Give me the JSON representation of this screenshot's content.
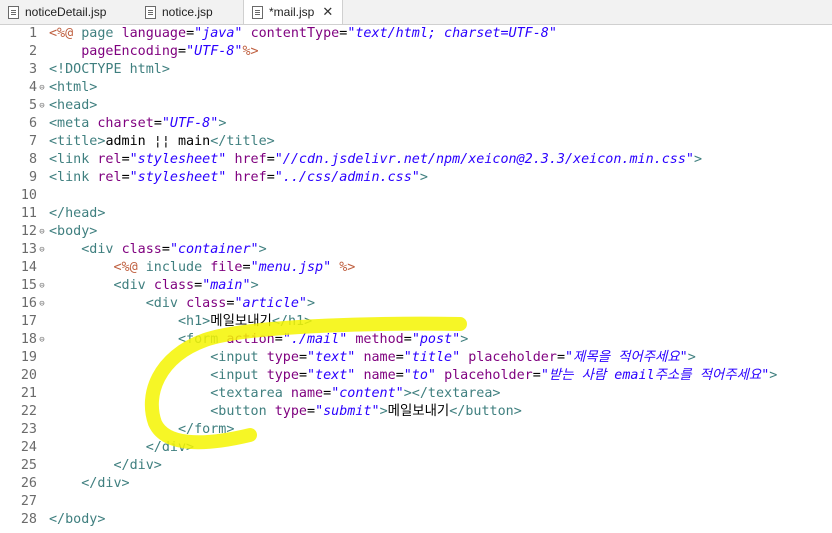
{
  "tabs": [
    {
      "label": "noticeDetail.jsp",
      "active": false
    },
    {
      "label": "notice.jsp",
      "active": false
    },
    {
      "label": "*mail.jsp",
      "active": true,
      "close": "✕"
    }
  ],
  "colors": {
    "tag": "#3f7f7f",
    "attribute": "#7f007f",
    "string": "#2a00ff",
    "directive": "#bf5f3f",
    "highlighter": "#f5f500"
  },
  "lines": [
    {
      "n": "1",
      "fold": "",
      "tokens": [
        [
          "d",
          "<%@ "
        ],
        [
          "t",
          "page "
        ],
        [
          "a",
          "language"
        ],
        [
          "x",
          "="
        ],
        [
          "s",
          "\"java\""
        ],
        [
          "x",
          " "
        ],
        [
          "a",
          "contentType"
        ],
        [
          "x",
          "="
        ],
        [
          "s",
          "\"text/html; charset=UTF-8\""
        ]
      ]
    },
    {
      "n": "2",
      "fold": "",
      "tokens": [
        [
          "x",
          "    "
        ],
        [
          "a",
          "pageEncoding"
        ],
        [
          "x",
          "="
        ],
        [
          "s",
          "\"UTF-8\""
        ],
        [
          "d",
          "%>"
        ]
      ]
    },
    {
      "n": "3",
      "fold": "",
      "tokens": [
        [
          "t",
          "<!DOCTYPE html>"
        ]
      ]
    },
    {
      "n": "4",
      "fold": "⊖",
      "tokens": [
        [
          "t",
          "<html>"
        ]
      ]
    },
    {
      "n": "5",
      "fold": "⊖",
      "tokens": [
        [
          "t",
          "<head>"
        ]
      ]
    },
    {
      "n": "6",
      "fold": "",
      "tokens": [
        [
          "t",
          "<meta "
        ],
        [
          "a",
          "charset"
        ],
        [
          "x",
          "="
        ],
        [
          "s",
          "\"UTF-8\""
        ],
        [
          "t",
          ">"
        ]
      ]
    },
    {
      "n": "7",
      "fold": "",
      "tokens": [
        [
          "t",
          "<title>"
        ],
        [
          "x",
          "admin ¦¦ main"
        ],
        [
          "t",
          "</title>"
        ]
      ]
    },
    {
      "n": "8",
      "fold": "",
      "tokens": [
        [
          "t",
          "<link "
        ],
        [
          "a",
          "rel"
        ],
        [
          "x",
          "="
        ],
        [
          "s",
          "\"stylesheet\""
        ],
        [
          "x",
          " "
        ],
        [
          "a",
          "href"
        ],
        [
          "x",
          "="
        ],
        [
          "s",
          "\"//cdn.jsdelivr.net/npm/xeicon@2.3.3/xeicon.min.css\""
        ],
        [
          "t",
          ">"
        ]
      ]
    },
    {
      "n": "9",
      "fold": "",
      "tokens": [
        [
          "t",
          "<link "
        ],
        [
          "a",
          "rel"
        ],
        [
          "x",
          "="
        ],
        [
          "s",
          "\"stylesheet\""
        ],
        [
          "x",
          " "
        ],
        [
          "a",
          "href"
        ],
        [
          "x",
          "="
        ],
        [
          "s",
          "\"../css/admin.css\""
        ],
        [
          "t",
          ">"
        ]
      ]
    },
    {
      "n": "10",
      "fold": "",
      "tokens": []
    },
    {
      "n": "11",
      "fold": "",
      "tokens": [
        [
          "t",
          "</head>"
        ]
      ]
    },
    {
      "n": "12",
      "fold": "⊖",
      "tokens": [
        [
          "t",
          "<body>"
        ]
      ]
    },
    {
      "n": "13",
      "fold": "⊖",
      "tokens": [
        [
          "x",
          "    "
        ],
        [
          "t",
          "<div "
        ],
        [
          "a",
          "class"
        ],
        [
          "x",
          "="
        ],
        [
          "s",
          "\"container\""
        ],
        [
          "t",
          ">"
        ]
      ]
    },
    {
      "n": "14",
      "fold": "",
      "tokens": [
        [
          "x",
          "        "
        ],
        [
          "d",
          "<%@ "
        ],
        [
          "t",
          "include "
        ],
        [
          "a",
          "file"
        ],
        [
          "x",
          "="
        ],
        [
          "s",
          "\"menu.jsp\""
        ],
        [
          "x",
          " "
        ],
        [
          "d",
          "%>"
        ]
      ]
    },
    {
      "n": "15",
      "fold": "⊖",
      "tokens": [
        [
          "x",
          "        "
        ],
        [
          "t",
          "<div "
        ],
        [
          "a",
          "class"
        ],
        [
          "x",
          "="
        ],
        [
          "s",
          "\"main\""
        ],
        [
          "t",
          ">"
        ]
      ]
    },
    {
      "n": "16",
      "fold": "⊖",
      "tokens": [
        [
          "x",
          "            "
        ],
        [
          "t",
          "<div "
        ],
        [
          "a",
          "class"
        ],
        [
          "x",
          "="
        ],
        [
          "s",
          "\"article\""
        ],
        [
          "t",
          ">"
        ]
      ]
    },
    {
      "n": "17",
      "fold": "",
      "tokens": [
        [
          "x",
          "                "
        ],
        [
          "t",
          "<h1>"
        ],
        [
          "x",
          "메일보내기"
        ],
        [
          "t",
          "</h1>"
        ]
      ]
    },
    {
      "n": "18",
      "fold": "⊖",
      "tokens": [
        [
          "x",
          "                "
        ],
        [
          "t",
          "<form "
        ],
        [
          "a",
          "action"
        ],
        [
          "x",
          "="
        ],
        [
          "s",
          "\"./mail\""
        ],
        [
          "x",
          " "
        ],
        [
          "a",
          "method"
        ],
        [
          "x",
          "="
        ],
        [
          "s",
          "\"post\""
        ],
        [
          "t",
          ">"
        ]
      ]
    },
    {
      "n": "19",
      "fold": "",
      "tokens": [
        [
          "x",
          "                    "
        ],
        [
          "t",
          "<input "
        ],
        [
          "a",
          "type"
        ],
        [
          "x",
          "="
        ],
        [
          "s",
          "\"text\""
        ],
        [
          "x",
          " "
        ],
        [
          "a",
          "name"
        ],
        [
          "x",
          "="
        ],
        [
          "s",
          "\"title\""
        ],
        [
          "x",
          " "
        ],
        [
          "a",
          "placeholder"
        ],
        [
          "x",
          "="
        ],
        [
          "s",
          "\"제목을 적어주세요\""
        ],
        [
          "t",
          ">"
        ]
      ]
    },
    {
      "n": "20",
      "fold": "",
      "tokens": [
        [
          "x",
          "                    "
        ],
        [
          "t",
          "<input "
        ],
        [
          "a",
          "type"
        ],
        [
          "x",
          "="
        ],
        [
          "s",
          "\"text\""
        ],
        [
          "x",
          " "
        ],
        [
          "a",
          "name"
        ],
        [
          "x",
          "="
        ],
        [
          "s",
          "\"to\""
        ],
        [
          "x",
          " "
        ],
        [
          "a",
          "placeholder"
        ],
        [
          "x",
          "="
        ],
        [
          "s",
          "\"받는 사람 email주소를 적어주세요\""
        ],
        [
          "t",
          ">"
        ]
      ]
    },
    {
      "n": "21",
      "fold": "",
      "tokens": [
        [
          "x",
          "                    "
        ],
        [
          "t",
          "<textarea "
        ],
        [
          "a",
          "name"
        ],
        [
          "x",
          "="
        ],
        [
          "s",
          "\"content\""
        ],
        [
          "t",
          "></textarea>"
        ]
      ]
    },
    {
      "n": "22",
      "fold": "",
      "tokens": [
        [
          "x",
          "                    "
        ],
        [
          "t",
          "<button "
        ],
        [
          "a",
          "type"
        ],
        [
          "x",
          "="
        ],
        [
          "s",
          "\"submit\""
        ],
        [
          "t",
          ">"
        ],
        [
          "x",
          "메일보내기"
        ],
        [
          "t",
          "</button>"
        ]
      ]
    },
    {
      "n": "23",
      "fold": "",
      "tokens": [
        [
          "x",
          "                "
        ],
        [
          "t",
          "</form>"
        ]
      ]
    },
    {
      "n": "24",
      "fold": "",
      "tokens": [
        [
          "x",
          "            "
        ],
        [
          "t",
          "</div>"
        ]
      ]
    },
    {
      "n": "25",
      "fold": "",
      "tokens": [
        [
          "x",
          "        "
        ],
        [
          "t",
          "</div>"
        ]
      ]
    },
    {
      "n": "26",
      "fold": "",
      "tokens": [
        [
          "x",
          "    "
        ],
        [
          "t",
          "</div>"
        ]
      ]
    },
    {
      "n": "27",
      "fold": "",
      "tokens": []
    },
    {
      "n": "28",
      "fold": "",
      "tokens": [
        [
          "t",
          "</body>"
        ]
      ]
    }
  ]
}
